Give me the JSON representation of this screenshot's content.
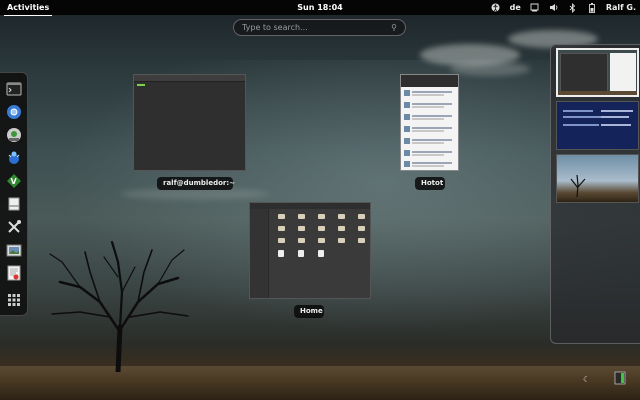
{
  "topbar": {
    "activities": "Activities",
    "clock": "Sun 18:04",
    "keyboard_layout": "de",
    "user": "Ralf G.",
    "icons": [
      "accessibility-icon",
      "network-icon",
      "volume-icon",
      "bluetooth-icon",
      "battery-icon"
    ]
  },
  "search": {
    "placeholder": "Type to search..."
  },
  "dash": {
    "items": [
      "terminal-icon",
      "chromium-icon",
      "disk-utility-icon",
      "ladybug-icon",
      "vim-icon",
      "file-manager-icon",
      "settings-tools-icon",
      "image-viewer-icon",
      "text-editor-icon",
      "show-apps-icon"
    ]
  },
  "windows": [
    {
      "caption": "ralf@dumbledor:~"
    },
    {
      "caption": "Hotot"
    },
    {
      "caption": "Home"
    }
  ],
  "workspaces": {
    "count": 3,
    "active_index": 0
  },
  "colors": {
    "panel": "#050505",
    "terminal_prompt": "#7ad14a",
    "workspace2": "#14245a"
  }
}
